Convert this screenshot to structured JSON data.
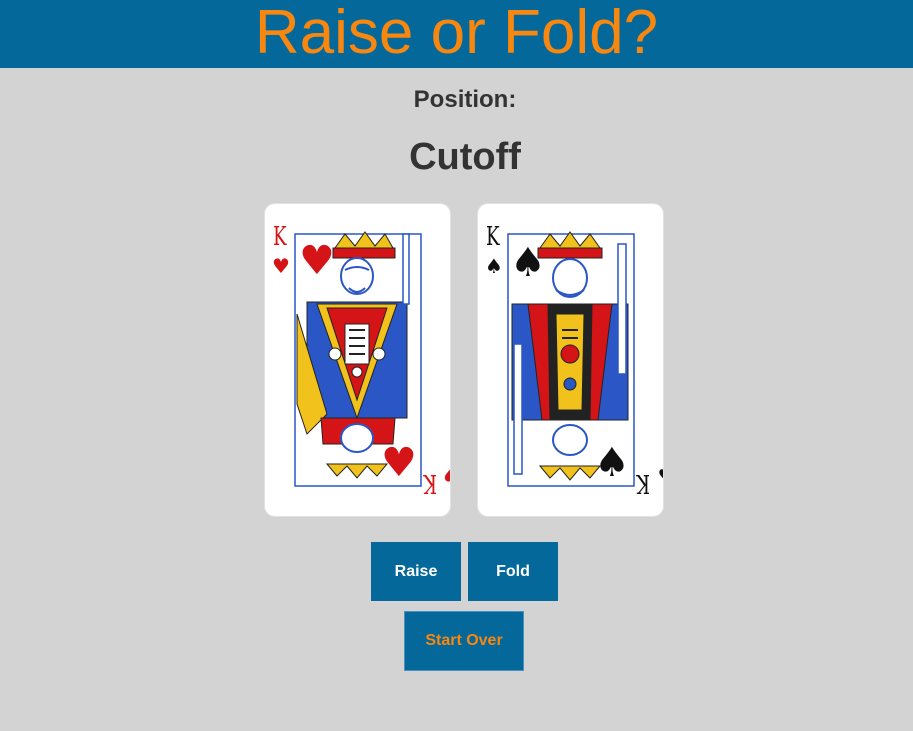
{
  "header": {
    "title": "Raise or Fold?",
    "background_color": "#05689b",
    "title_color": "#f7870f"
  },
  "position": {
    "label": "Position:",
    "value": "Cutoff"
  },
  "cards": [
    {
      "rank": "K",
      "suit": "♥",
      "suit_name": "hearts",
      "color": "#d41417",
      "art": "king-of-hearts-illustration"
    },
    {
      "rank": "K",
      "suit": "♠",
      "suit_name": "spades",
      "color": "#111111",
      "art": "king-of-spades-illustration"
    }
  ],
  "actions": {
    "raise_label": "Raise",
    "fold_label": "Fold",
    "start_over_label": "Start Over"
  },
  "colors": {
    "page_background": "#d3d3d3",
    "button_background": "#05689b",
    "button_text": "#ffffff",
    "start_over_text": "#f7870f"
  }
}
